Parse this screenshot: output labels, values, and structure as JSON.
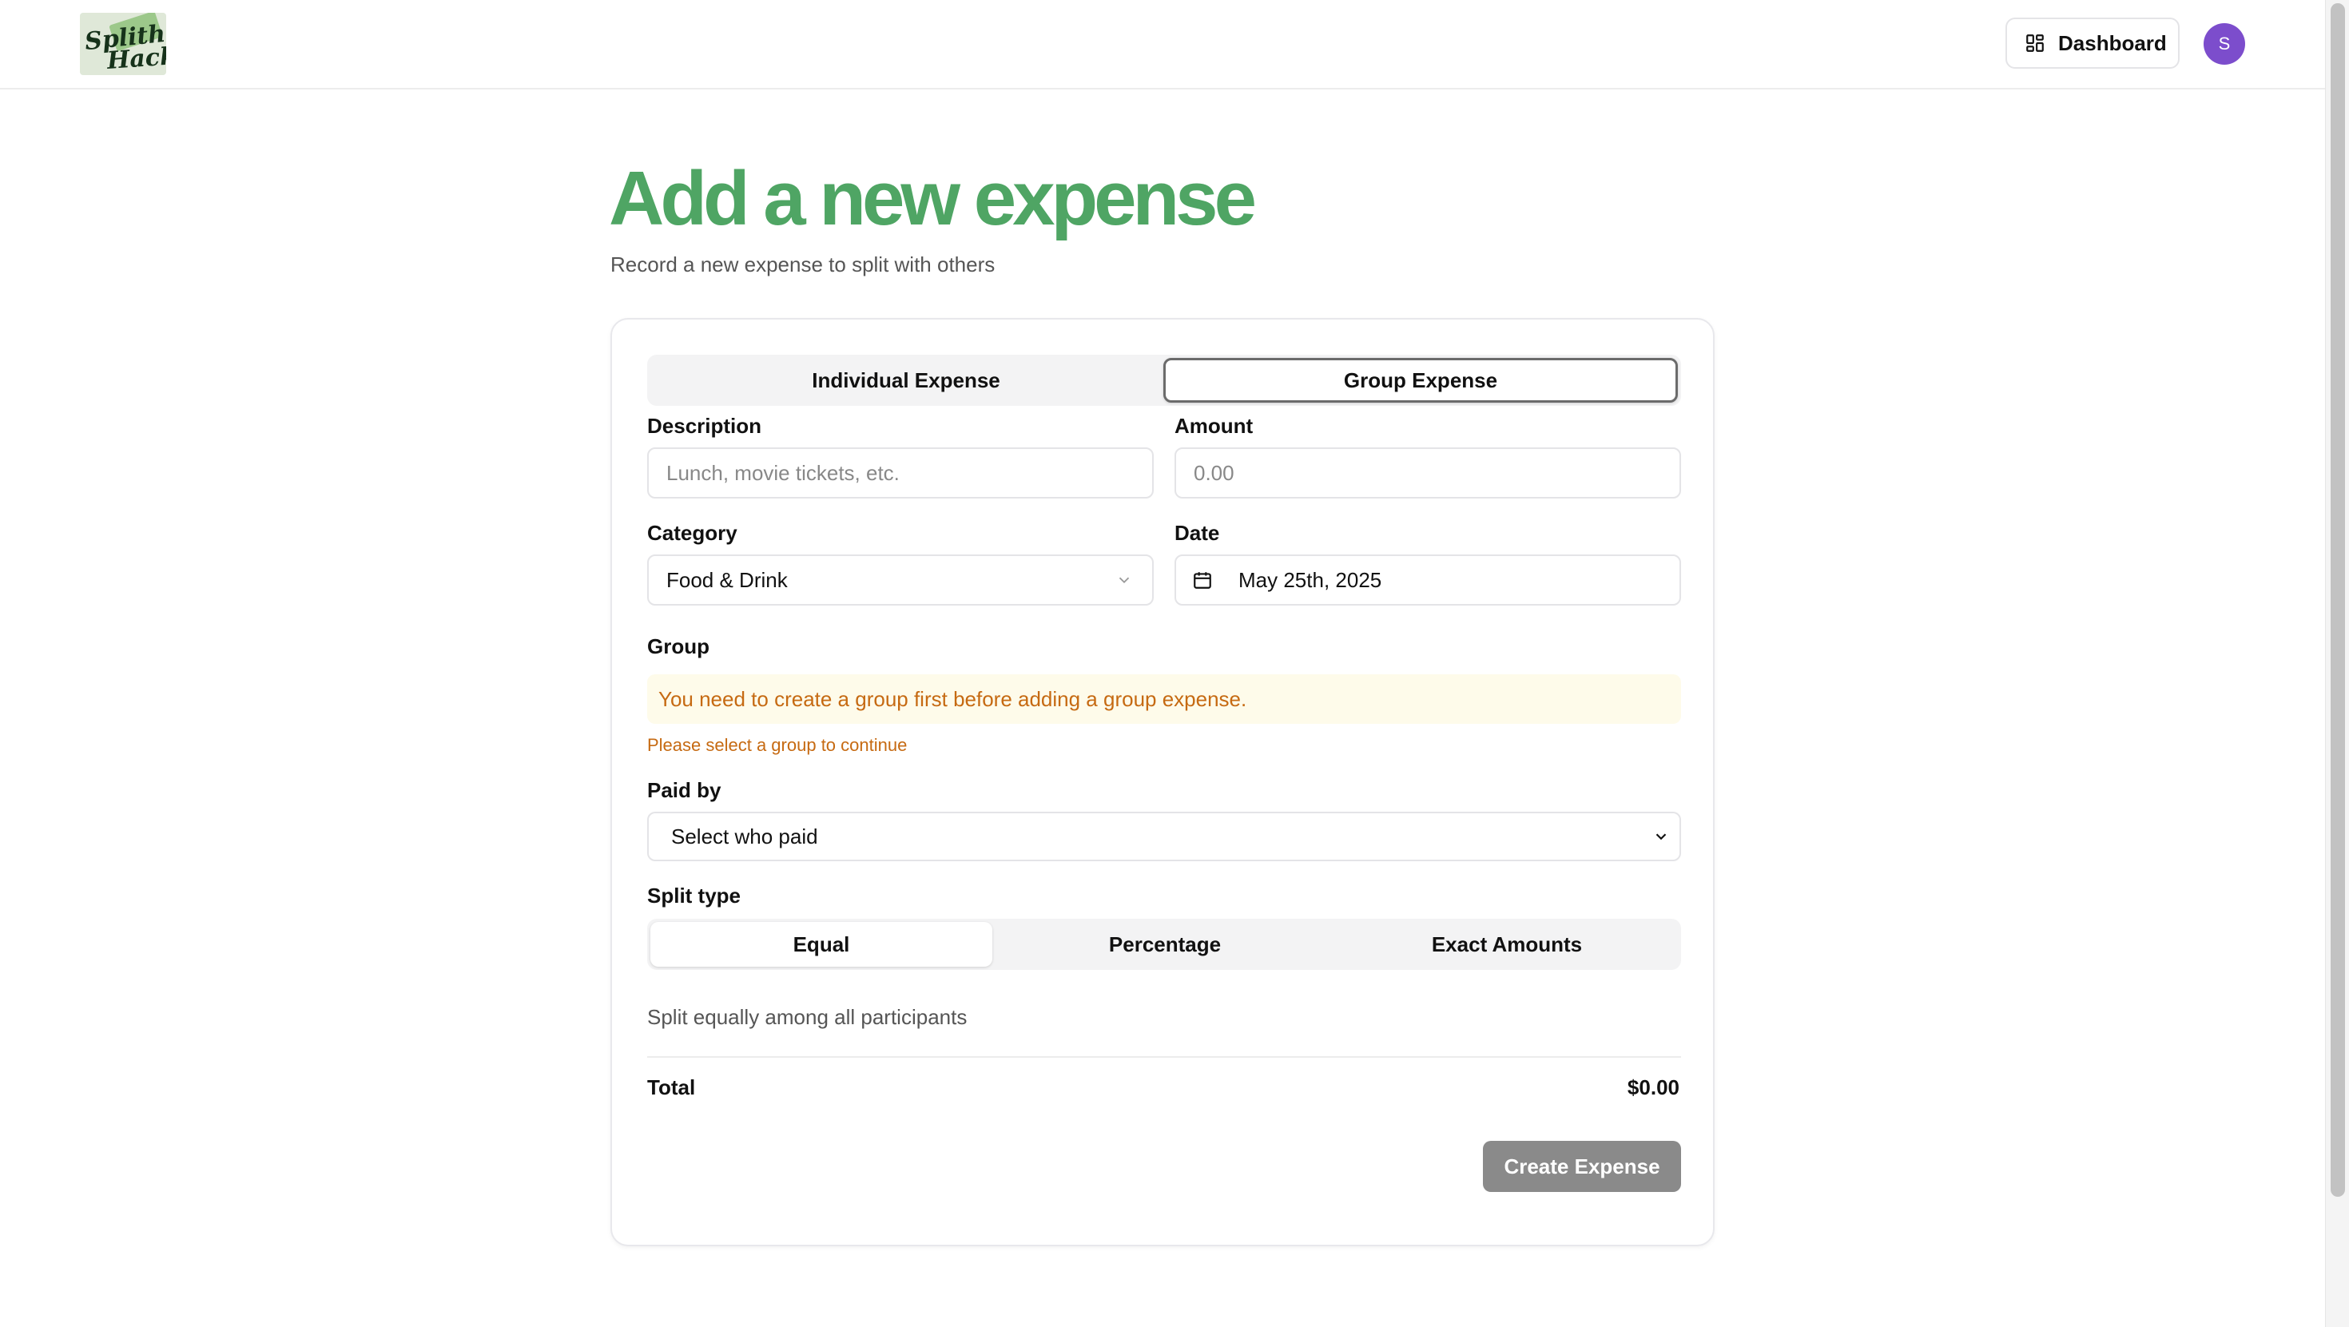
{
  "app": {
    "logo_text_line1": "Splith",
    "logo_text_line2": "Hack"
  },
  "header": {
    "dashboard_label": "Dashboard",
    "avatar_initial": "S"
  },
  "page": {
    "title": "Add a new expense",
    "subtitle": "Record a new expense to split with others"
  },
  "form": {
    "tabs": [
      {
        "label": "Individual Expense",
        "active": false
      },
      {
        "label": "Group Expense",
        "active": true
      }
    ],
    "description": {
      "label": "Description",
      "placeholder": "Lunch, movie tickets, etc.",
      "value": ""
    },
    "amount": {
      "label": "Amount",
      "placeholder": "0.00",
      "value": ""
    },
    "category": {
      "label": "Category",
      "value": "Food & Drink"
    },
    "date": {
      "label": "Date",
      "value": "May 25th, 2025"
    },
    "group": {
      "label": "Group",
      "warning": "You need to create a group first before adding a group expense.",
      "error": "Please select a group to continue"
    },
    "paid_by": {
      "label": "Paid by",
      "value": "Select who paid"
    },
    "split_type": {
      "label": "Split type",
      "options": [
        {
          "label": "Equal",
          "active": true
        },
        {
          "label": "Percentage",
          "active": false
        },
        {
          "label": "Exact Amounts",
          "active": false
        }
      ],
      "hint": "Split equally among all participants"
    },
    "total": {
      "label": "Total",
      "value": "$0.00"
    },
    "submit_label": "Create Expense"
  },
  "colors": {
    "accent_green": "#4fa564",
    "warning_text": "#c66a12",
    "warning_bg": "#fefbea",
    "avatar_bg": "#7c4dcc",
    "button_disabled": "#8a8a8a"
  }
}
